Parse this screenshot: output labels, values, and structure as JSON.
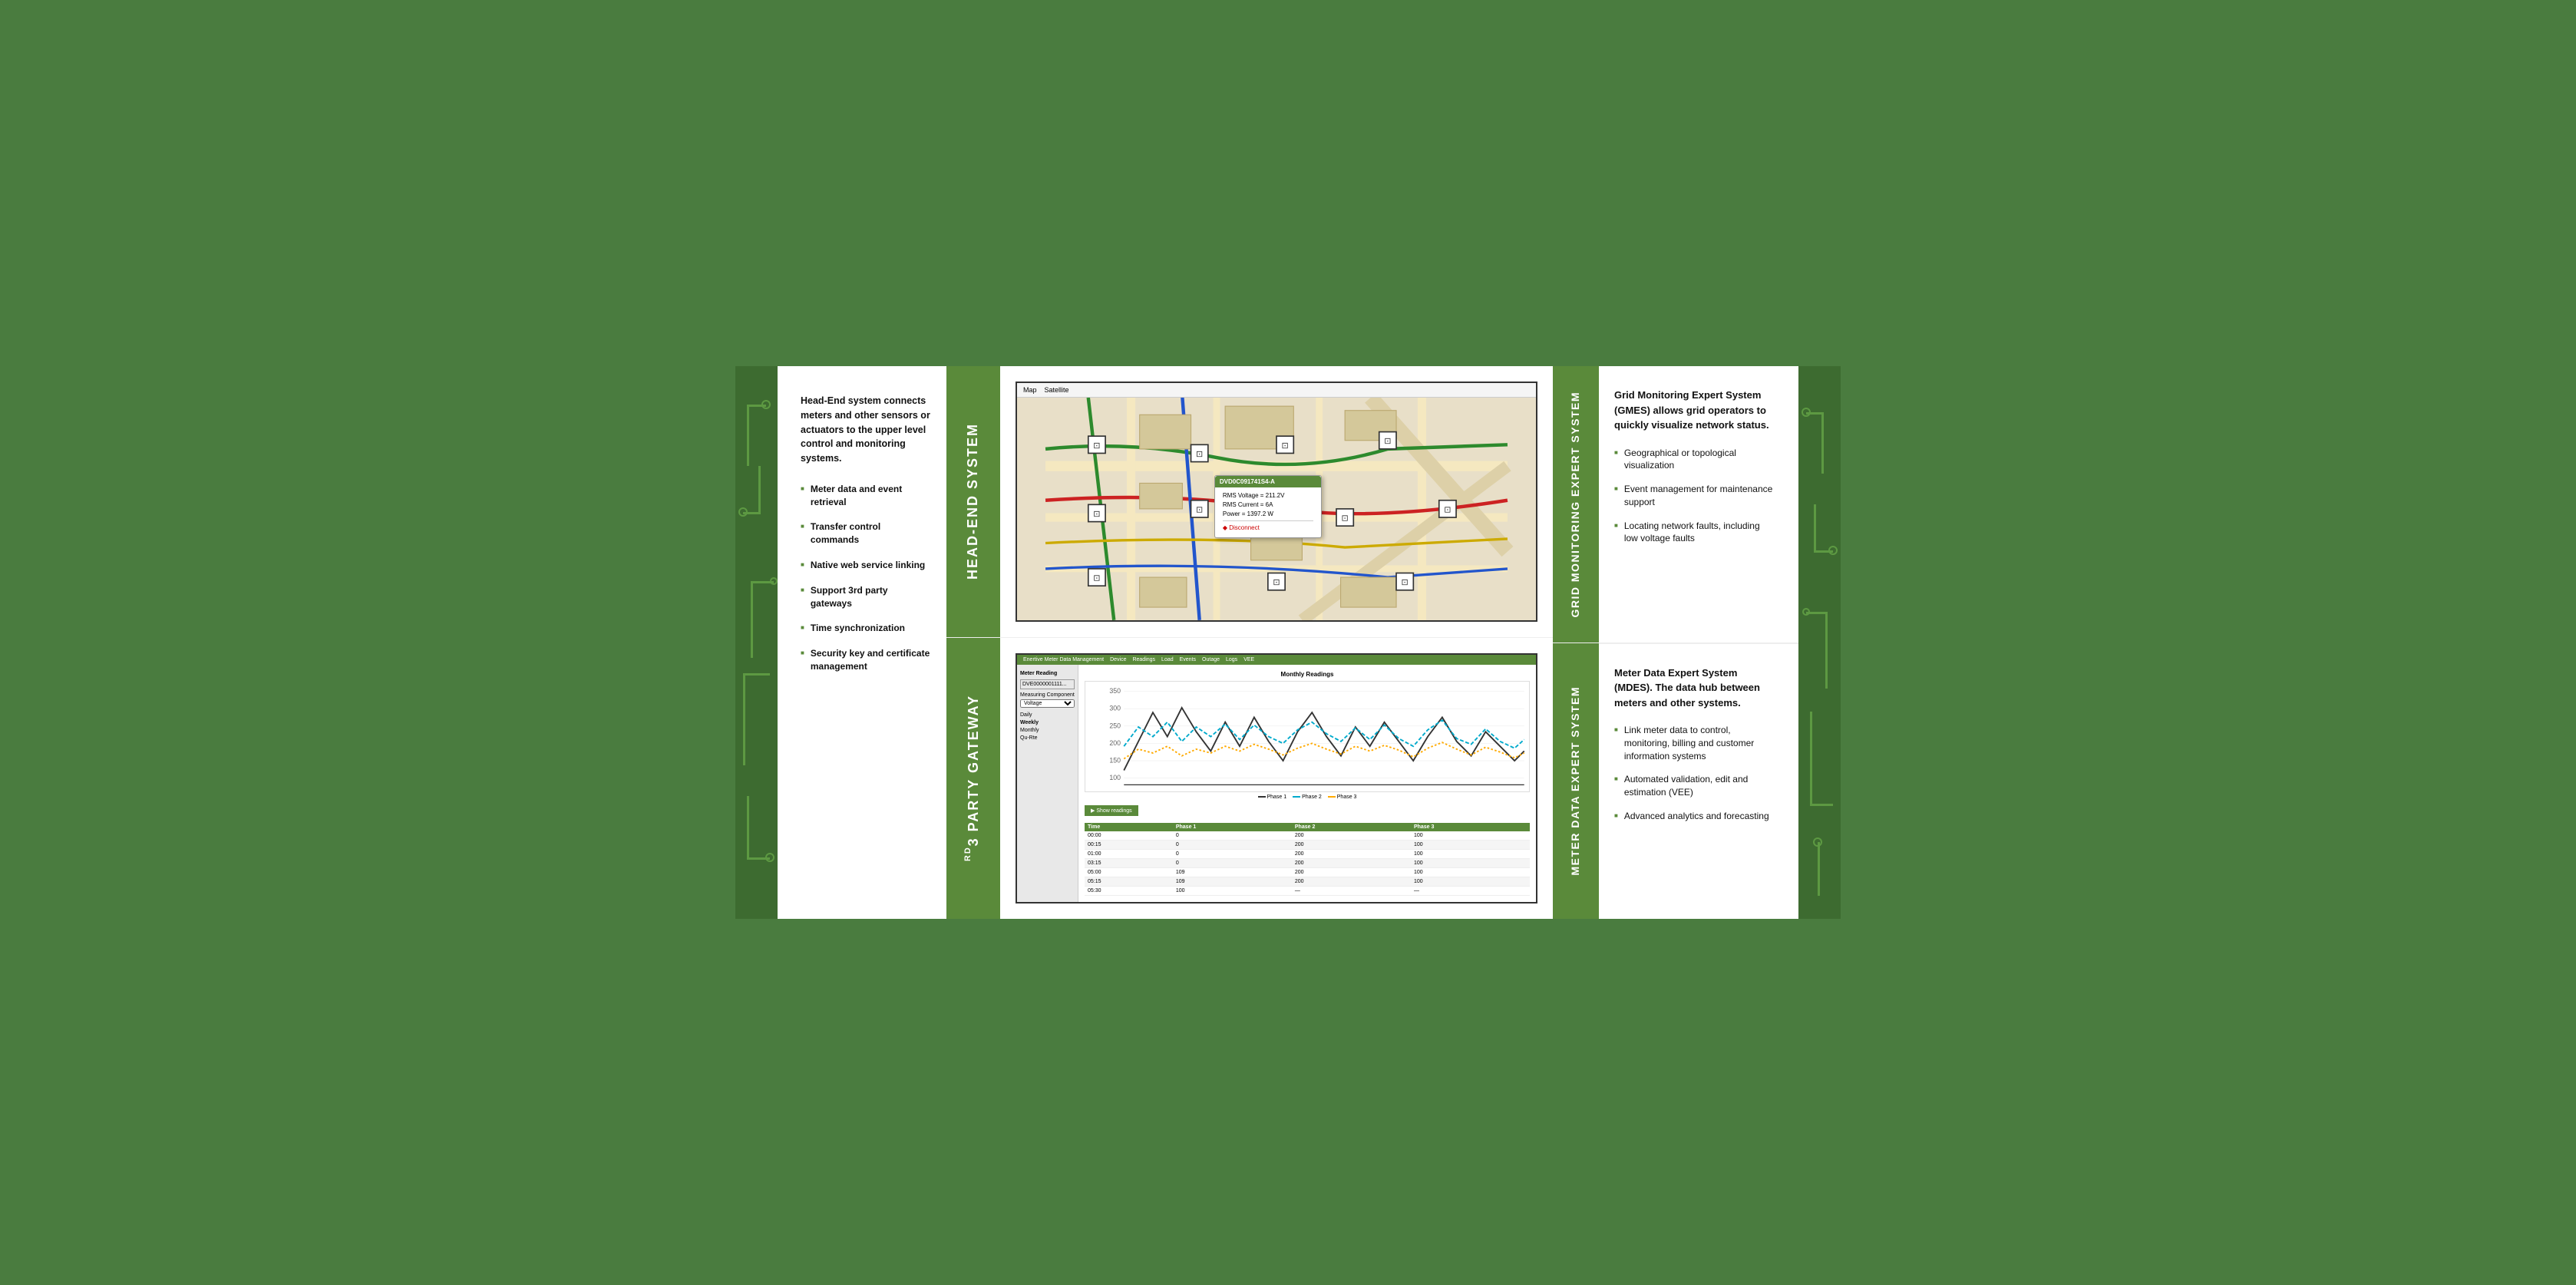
{
  "left": {
    "intro": "Head-End system connects meters and other sensors or actuators to the upper level control and monitoring systems.",
    "bullets": [
      "Meter data and event retrieval",
      "Transfer control commands",
      "Native web service linking",
      "Support 3rd party gateways",
      "Time synchronization",
      "Security key and certificate management"
    ]
  },
  "center_top": {
    "label": "HEAD-END SYSTEM",
    "map_toolbar": [
      "Map",
      "Satellite"
    ],
    "popup": {
      "title": "DVD0C091741S4-A",
      "rows": [
        "RMS Voltage = 211.2V",
        "RMS Current = 6A",
        "Power = 1397.2 W"
      ],
      "link": "Disconnect"
    }
  },
  "center_bottom": {
    "label_superscript": "rd",
    "label_prefix": "3",
    "label_main": "PARTY GATEWAY",
    "meter_title": "Monthly Readings",
    "meter_tabs": [
      "Phase 1",
      "Phase 2",
      "Phase 3"
    ],
    "readings_header": [
      "Time",
      "Phase 1",
      "Phase 2",
      "Phase 3"
    ],
    "readings_rows": [
      [
        "00:00",
        "0",
        "200",
        "100"
      ],
      [
        "00:15",
        "0",
        "200",
        "100"
      ],
      [
        "01:00",
        "0",
        "200",
        "100"
      ],
      [
        "03:15",
        "0",
        "200",
        "100"
      ],
      [
        "05:00",
        "109",
        "200",
        "100"
      ],
      [
        "05:15",
        "109",
        "200",
        "100"
      ],
      [
        "05:30",
        "100",
        "—",
        "—"
      ]
    ]
  },
  "right_top": {
    "green_label": "GRID MONITORING EXPERT SYSTEM",
    "title": "Grid Monitoring Expert System (GMES) allows grid operators to quickly visualize network status.",
    "bullets": [
      "Geographical or topological visualization",
      "Event management for maintenance support",
      "Locating network faults, including low voltage faults"
    ]
  },
  "right_bottom": {
    "green_label": "METER DATA EXPERT SYSTEM",
    "title": "Meter Data Expert System (MDES). The data hub between meters and other systems.",
    "bullets": [
      "Link meter data to control, monitoring, billing and customer information systems",
      "Automated validation, edit and estimation (VEE)",
      "Advanced analytics and forecasting"
    ]
  }
}
